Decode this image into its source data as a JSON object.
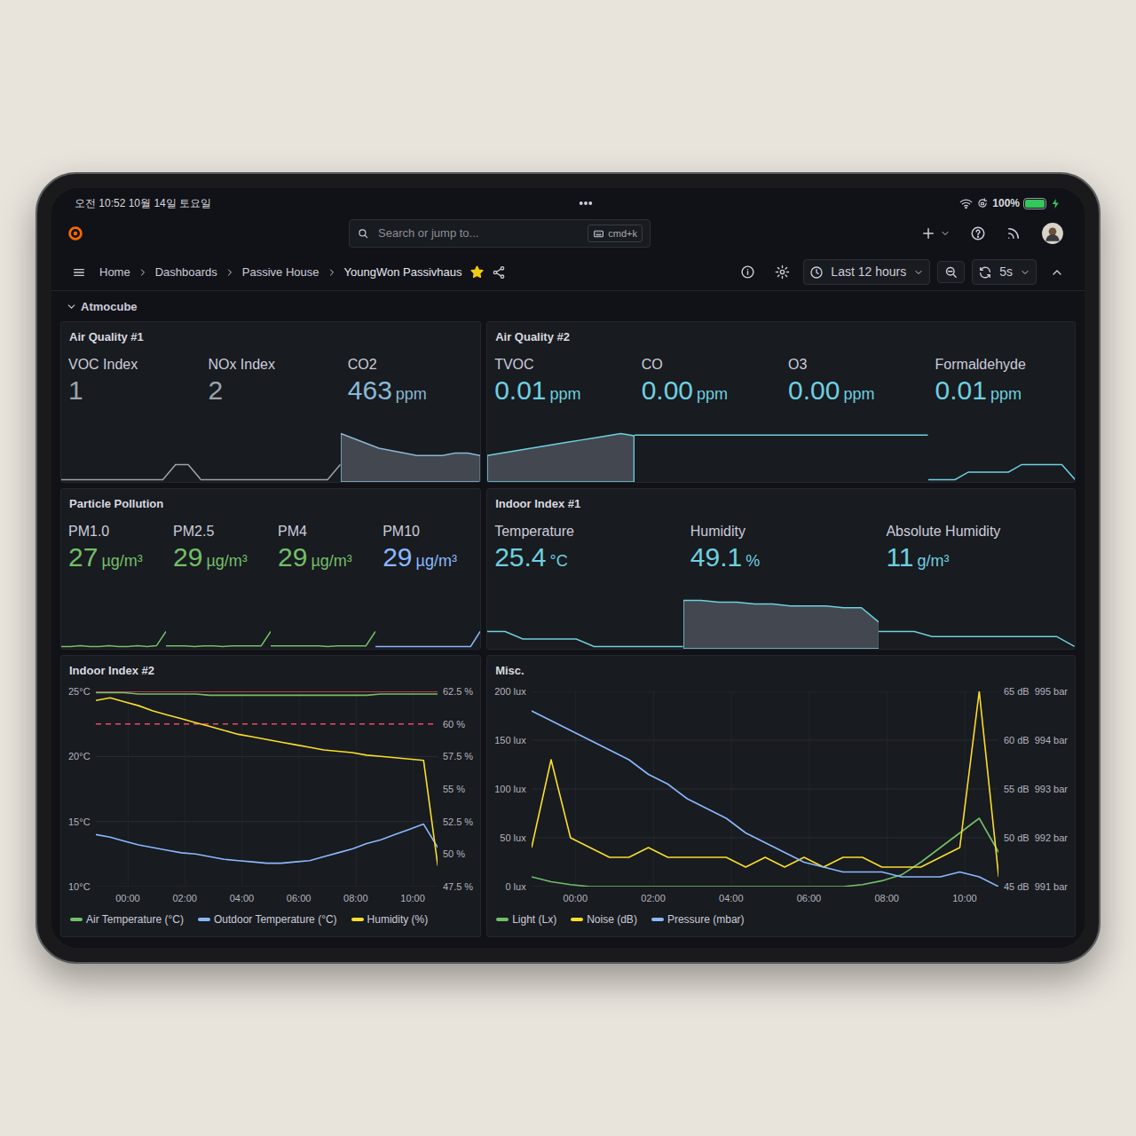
{
  "status_bar": {
    "clock": "오전 10:52 10월 14일 토요일",
    "battery": "100%",
    "battery_level": 1.0,
    "charging": true
  },
  "toolbar": {
    "search_placeholder": "Search or jump to...",
    "shortcut": "cmd+k",
    "time_range": "Last 12 hours",
    "refresh": "5s"
  },
  "breadcrumbs": [
    {
      "label": "Home"
    },
    {
      "label": "Dashboards"
    },
    {
      "label": "Passive House"
    },
    {
      "label": "YoungWon Passivhaus"
    }
  ],
  "starred": true,
  "row_title": "Atmocube",
  "stat_panels": [
    {
      "title": "Air Quality #1",
      "stats": [
        {
          "label": "VOC Index",
          "value": "1",
          "color": "#9aa4ad",
          "kind": "line",
          "spark": [
            1,
            1,
            1,
            1,
            1,
            1,
            1,
            1,
            1,
            2,
            2,
            1
          ]
        },
        {
          "label": "NOx Index",
          "value": "2",
          "color": "#9aa4ad",
          "kind": "line",
          "spark": [
            1,
            1,
            1,
            1,
            1,
            1,
            1,
            1,
            1,
            1,
            1,
            2
          ]
        },
        {
          "label": "CO2",
          "value": "463",
          "unit": "ppm",
          "color": "#8ab8d6",
          "kind": "area",
          "spark": [
            472,
            470,
            468,
            466,
            465,
            464,
            463,
            463,
            463,
            464,
            464,
            463
          ]
        }
      ]
    },
    {
      "title": "Air Quality #2",
      "stats": [
        {
          "label": "TVOC",
          "value": "0.01",
          "unit": "ppm",
          "color": "#6ed0e0",
          "kind": "area",
          "spark": [
            0.002,
            0.003,
            0.004,
            0.005,
            0.006,
            0.007,
            0.008,
            0.009,
            0.01,
            0.011,
            0.012,
            0.011
          ]
        },
        {
          "label": "CO",
          "value": "0.00",
          "unit": "ppm",
          "color": "#6ed0e0",
          "kind": "line",
          "spark": [
            0,
            0,
            0,
            0,
            0,
            0,
            0,
            0,
            0,
            0,
            0,
            0
          ]
        },
        {
          "label": "O3",
          "value": "0.00",
          "unit": "ppm",
          "color": "#6ed0e0",
          "kind": "line",
          "spark": [
            0,
            0,
            0,
            0,
            0,
            0,
            0,
            0,
            0,
            0,
            0,
            0
          ]
        },
        {
          "label": "Formaldehyde",
          "value": "0.01",
          "unit": "ppm",
          "color": "#6ed0e0",
          "kind": "line",
          "spark": [
            0.01,
            0.01,
            0.01,
            0.011,
            0.011,
            0.011,
            0.011,
            0.012,
            0.012,
            0.012,
            0.012,
            0.01
          ]
        }
      ]
    },
    {
      "title": "Particle Pollution",
      "stats": [
        {
          "label": "PM1.0",
          "value": "27",
          "unit": "µg/m³",
          "color": "#73bf69",
          "kind": "line",
          "spark": [
            8,
            8,
            9,
            8,
            8,
            9,
            8,
            8,
            9,
            8,
            9,
            27
          ]
        },
        {
          "label": "PM2.5",
          "value": "29",
          "unit": "µg/m³",
          "color": "#73bf69",
          "kind": "line",
          "spark": [
            9,
            9,
            9,
            8,
            9,
            9,
            8,
            9,
            9,
            9,
            9,
            29
          ]
        },
        {
          "label": "PM4",
          "value": "29",
          "unit": "µg/m³",
          "color": "#73bf69",
          "kind": "line",
          "spark": [
            9,
            9,
            9,
            9,
            9,
            9,
            8,
            9,
            9,
            9,
            9,
            29
          ]
        },
        {
          "label": "PM10",
          "value": "29",
          "unit": "µg/m³",
          "color": "#8ab8ff",
          "kind": "line",
          "spark": [
            9,
            9,
            9,
            9,
            9,
            9,
            9,
            9,
            9,
            9,
            9,
            29
          ]
        }
      ]
    },
    {
      "title": "Indoor Index #1",
      "stats": [
        {
          "label": "Temperature",
          "value": "25.4",
          "unit": "°C",
          "color": "#6ed0e0",
          "kind": "line",
          "spark": [
            25.6,
            25.6,
            25.5,
            25.5,
            25.5,
            25.5,
            25.4,
            25.4,
            25.4,
            25.4,
            25.4,
            25.4
          ]
        },
        {
          "label": "Humidity",
          "value": "49.1",
          "unit": "%",
          "color": "#6ed0e0",
          "kind": "area",
          "spark": [
            61,
            61,
            60,
            60,
            59,
            59,
            58,
            58,
            58,
            57,
            57,
            49
          ]
        },
        {
          "label": "Absolute Humidity",
          "value": "11",
          "unit": "g/m³",
          "color": "#6ed0e0",
          "kind": "line",
          "spark": [
            14,
            14,
            14,
            13,
            13,
            13,
            13,
            13,
            13,
            13,
            13,
            11
          ]
        }
      ]
    }
  ],
  "charts": [
    {
      "title": "Indoor Index #2",
      "axes": [
        {
          "side": "left",
          "labels": [
            "25°C",
            "20°C",
            "15°C",
            "10°C"
          ],
          "min": 10,
          "max": 25
        },
        {
          "side": "right",
          "labels": [
            "62.5 %",
            "60 %",
            "57.5 %",
            "55 %",
            "52.5 %",
            "50 %",
            "47.5 %"
          ],
          "min": 47.5,
          "max": 62.5
        }
      ],
      "thresholds": [
        {
          "axis": 1,
          "value": 62.5,
          "style": "solid",
          "color": "#f2495c"
        },
        {
          "axis": 1,
          "value": 60,
          "style": "dashed",
          "color": "#f2495c"
        }
      ],
      "x_ticks": [
        "00:00",
        "02:00",
        "04:00",
        "06:00",
        "08:00",
        "10:00"
      ],
      "series": [
        {
          "name": "Air Temperature (°C)",
          "axis": 0,
          "color": "#73bf69",
          "values": [
            24.9,
            24.9,
            24.9,
            24.8,
            24.8,
            24.8,
            24.8,
            24.8,
            24.7,
            24.7,
            24.7,
            24.7,
            24.7,
            24.7,
            24.7,
            24.7,
            24.7,
            24.7,
            24.7,
            24.7,
            24.8,
            24.8,
            24.8,
            24.8,
            24.8
          ]
        },
        {
          "name": "Outdoor Temperature (°C)",
          "axis": 0,
          "color": "#8ab8ff",
          "values": [
            14.0,
            13.8,
            13.5,
            13.2,
            13.0,
            12.8,
            12.6,
            12.5,
            12.3,
            12.1,
            12.0,
            11.9,
            11.8,
            11.8,
            11.9,
            12.0,
            12.3,
            12.6,
            12.9,
            13.3,
            13.6,
            14.0,
            14.4,
            14.8,
            13.0
          ]
        },
        {
          "name": "Humidity (%)",
          "axis": 1,
          "color": "#fade2a",
          "values": [
            61.8,
            62.0,
            61.7,
            61.4,
            61.0,
            60.7,
            60.4,
            60.1,
            59.8,
            59.5,
            59.2,
            59.0,
            58.8,
            58.6,
            58.4,
            58.2,
            58.0,
            57.9,
            57.8,
            57.6,
            57.5,
            57.4,
            57.3,
            57.2,
            49.1
          ]
        }
      ]
    },
    {
      "title": "Misc.",
      "axes": [
        {
          "side": "left",
          "labels": [
            "200 lux",
            "150 lux",
            "100 lux",
            "50 lux",
            "0 lux"
          ],
          "min": 0,
          "max": 200
        },
        {
          "side": "right",
          "labels": [
            "65 dB",
            "60 dB",
            "55 dB",
            "50 dB",
            "45 dB"
          ],
          "min": 45,
          "max": 65
        },
        {
          "side": "right",
          "labels": [
            "995 bar",
            "994 bar",
            "993 bar",
            "992 bar",
            "991 bar"
          ],
          "min": 991,
          "max": 995
        }
      ],
      "thresholds": [],
      "x_ticks": [
        "00:00",
        "02:00",
        "04:00",
        "06:00",
        "08:00",
        "10:00"
      ],
      "series": [
        {
          "name": "Light (Lx)",
          "axis": 0,
          "color": "#73bf69",
          "values": [
            10,
            5,
            2,
            0,
            0,
            0,
            0,
            0,
            0,
            0,
            0,
            0,
            0,
            0,
            0,
            0,
            0,
            2,
            6,
            12,
            25,
            40,
            55,
            70,
            35
          ]
        },
        {
          "name": "Noise (dB)",
          "axis": 1,
          "color": "#fade2a",
          "values": [
            49,
            58,
            50,
            49,
            48,
            48,
            49,
            48,
            48,
            48,
            48,
            47,
            48,
            47,
            48,
            47,
            48,
            48,
            47,
            47,
            47,
            48,
            49,
            65,
            46
          ]
        },
        {
          "name": "Pressure (mbar)",
          "axis": 2,
          "color": "#8ab8ff",
          "values": [
            994.6,
            994.4,
            994.2,
            994.0,
            993.8,
            993.6,
            993.3,
            993.1,
            992.8,
            992.6,
            992.4,
            992.1,
            991.9,
            991.7,
            991.5,
            991.4,
            991.3,
            991.3,
            991.3,
            991.2,
            991.2,
            991.2,
            991.3,
            991.2,
            991.0
          ]
        }
      ]
    }
  ]
}
